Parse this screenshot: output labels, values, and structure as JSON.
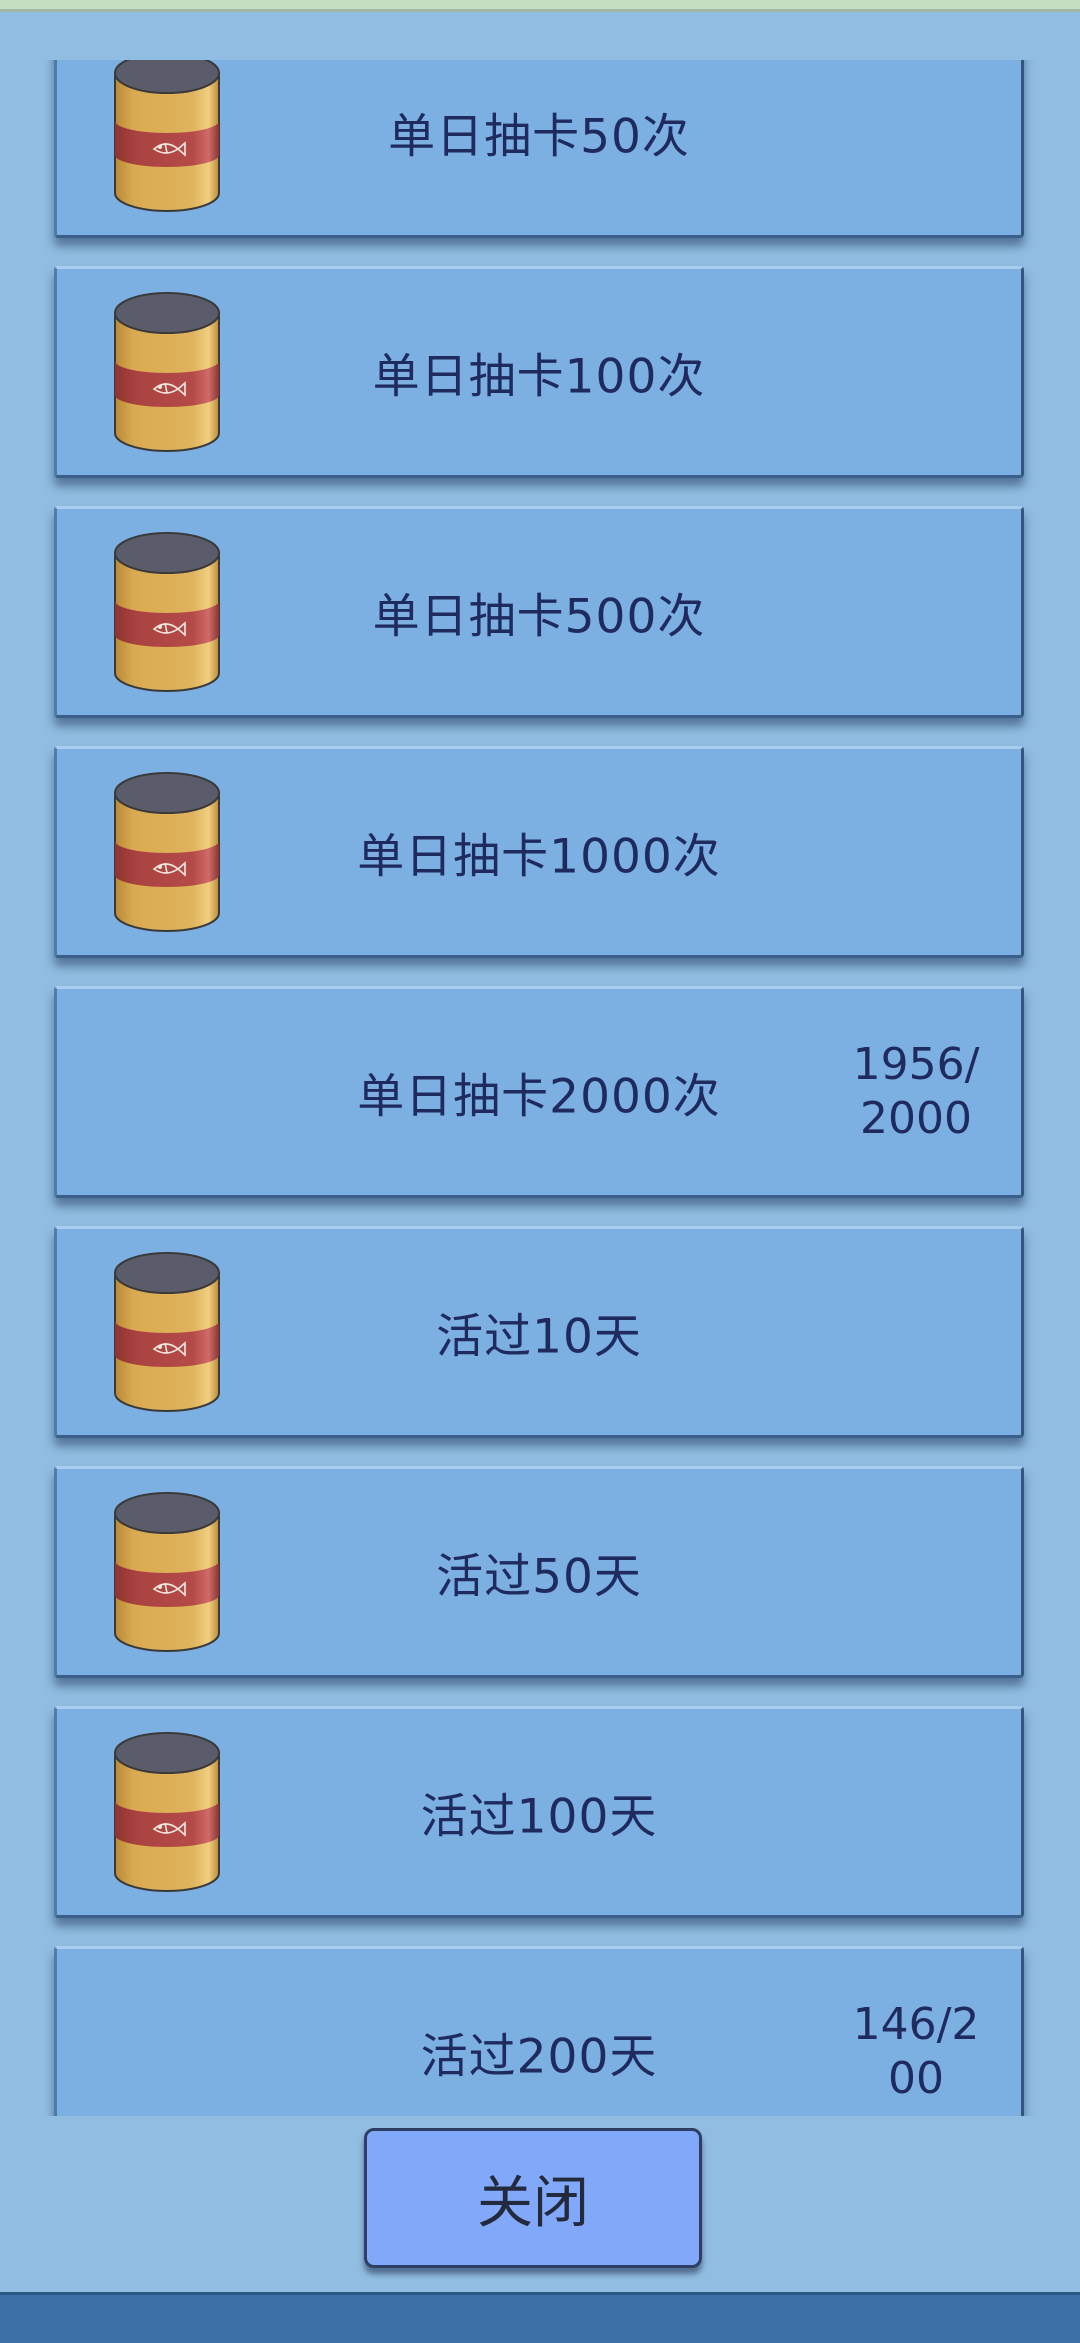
{
  "achievements": [
    {
      "title": "单日抽卡50次",
      "progress": "",
      "reward_icon": "fish-can-icon",
      "has_reward": true
    },
    {
      "title": "单日抽卡100次",
      "progress": "",
      "reward_icon": "fish-can-icon",
      "has_reward": true
    },
    {
      "title": "单日抽卡500次",
      "progress": "",
      "reward_icon": "fish-can-icon",
      "has_reward": true
    },
    {
      "title": "单日抽卡1000次",
      "progress": "",
      "reward_icon": "fish-can-icon",
      "has_reward": true
    },
    {
      "title": "单日抽卡2000次",
      "progress": "1956/2000",
      "reward_icon": "",
      "has_reward": false
    },
    {
      "title": "活过10天",
      "progress": "",
      "reward_icon": "fish-can-icon",
      "has_reward": true
    },
    {
      "title": "活过50天",
      "progress": "",
      "reward_icon": "fish-can-icon",
      "has_reward": true
    },
    {
      "title": "活过100天",
      "progress": "",
      "reward_icon": "fish-can-icon",
      "has_reward": true
    },
    {
      "title": "活过200天",
      "progress": "146/200",
      "reward_icon": "",
      "has_reward": false
    }
  ],
  "close_button": {
    "label": "关闭"
  },
  "colors": {
    "card_fill": "#7cafe2",
    "panel_background": "#91bde2",
    "button_fill": "#82a9f9",
    "text": "#1f2a5e",
    "can_body": "#d5a64e",
    "can_label": "#b24845",
    "can_lid": "#5b5c6b"
  }
}
